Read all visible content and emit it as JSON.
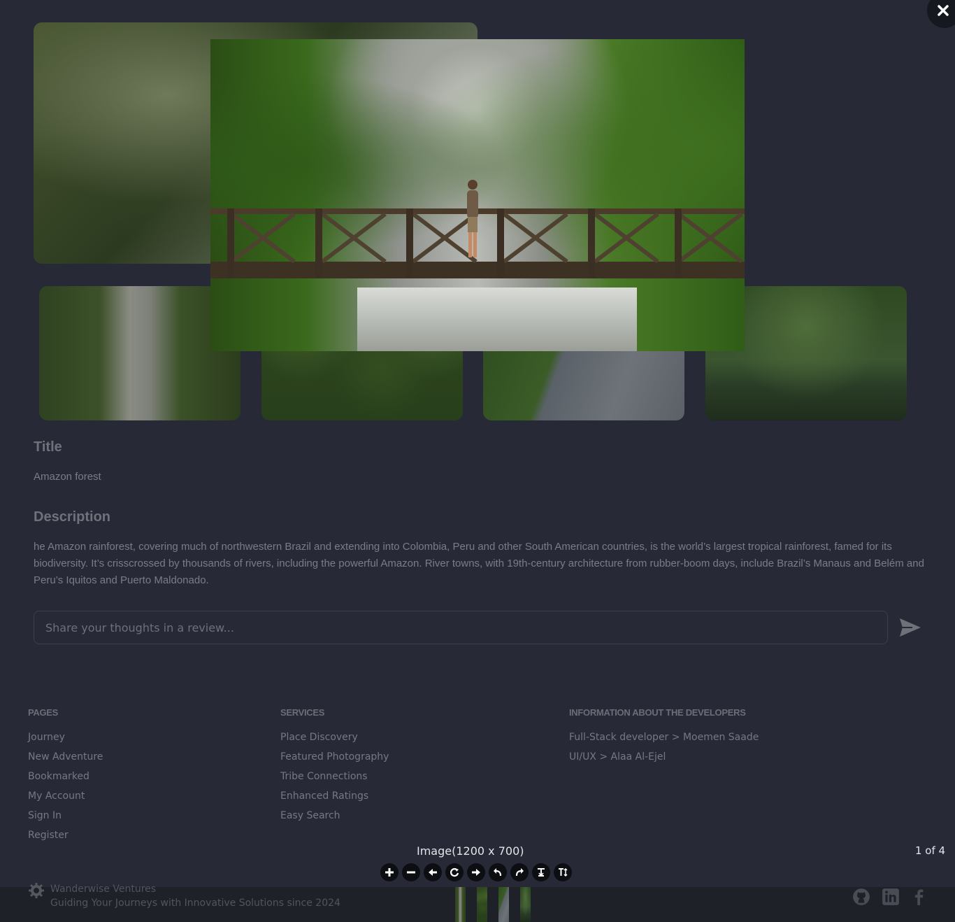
{
  "post": {
    "title_label": "Title",
    "title_value": "Amazon forest",
    "description_label": "Description",
    "description_value": "he Amazon rainforest, covering much of northwestern Brazil and extending into Colombia, Peru and other South American countries, is the world’s largest tropical rainforest, famed for its biodiversity. It’s crisscrossed by thousands of rivers, including the powerful Amazon. River towns, with 19th-century architecture from rubber-boom days, include Brazil’s Manaus and Belém and Peru’s Iquitos and Puerto Maldonado.",
    "review_placeholder": "Share your thoughts in a review..."
  },
  "footer": {
    "pages_heading": "PAGES",
    "pages": [
      "Journey",
      "New Adventure",
      "Bookmarked",
      "My Account",
      "Sign In",
      "Register"
    ],
    "services_heading": "SERVICES",
    "services": [
      "Place Discovery",
      "Featured Photography",
      "Tribe Connections",
      "Enhanced Ratings",
      "Easy Search"
    ],
    "developers_heading": "INFORMATION ABOUT THE DEVELOPERS",
    "developers": [
      "Full-Stack developer  > Moemen Saade",
      "UI/UX > Alaa Al-Ejel"
    ],
    "brand_name": "Wanderwise Ventures",
    "brand_tagline": "Guiding Your Journeys with Innovative Solutions since 2024",
    "social_icons": [
      "github-icon",
      "linkedin-icon",
      "facebook-icon"
    ]
  },
  "lightbox": {
    "caption": "Image(1200 x 700)",
    "counter": "1 of 4",
    "current_index": 1,
    "total": 4,
    "toolbar_icons": [
      "zoom-in-icon",
      "zoom-out-icon",
      "arrow-left-icon",
      "rotate-icon",
      "arrow-right-icon",
      "undo-icon",
      "redo-icon",
      "flip-vertical-icon",
      "flip-horizontal-icon"
    ]
  },
  "colors": {
    "page_bg": "#272a36",
    "overlay_text": "#e3e4e8",
    "footer_bar": "#1f2129"
  }
}
